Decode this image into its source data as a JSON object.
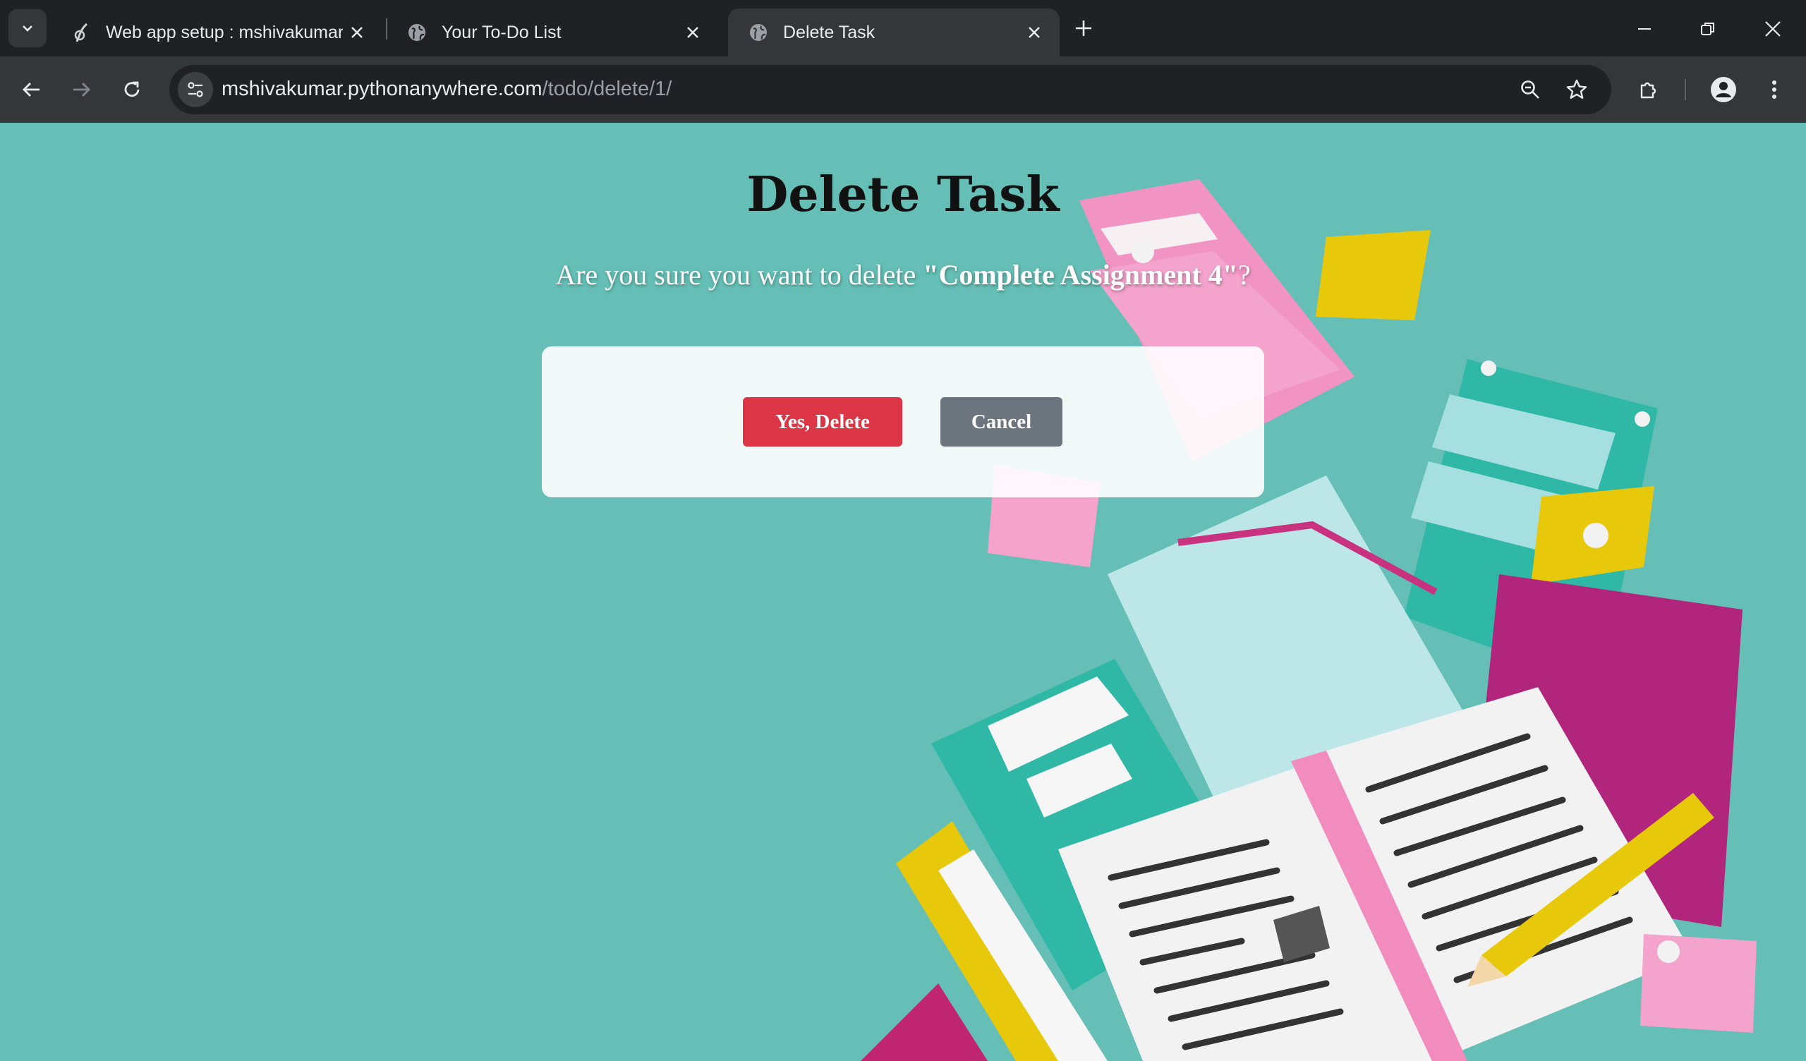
{
  "browser": {
    "tabs": [
      {
        "title": "Web app setup : mshivakumar :",
        "favicon": "pythonanywhere-icon",
        "active": false
      },
      {
        "title": "Your To-Do List",
        "favicon": "globe-icon",
        "active": false
      },
      {
        "title": "Delete Task",
        "favicon": "globe-icon",
        "active": true
      }
    ],
    "url_host": "mshivakumar.pythonanywhere.com",
    "url_path": "/todo/delete/1/"
  },
  "page": {
    "title": "Delete Task",
    "prompt_prefix": "Are you sure you want to delete ",
    "task_name": "\"Complete Assignment 4\"",
    "prompt_suffix": "?",
    "confirm_label": "Yes, Delete",
    "cancel_label": "Cancel"
  },
  "colors": {
    "page_background": "#65bfb6",
    "delete_button": "#dc3545",
    "cancel_button": "#6c757d",
    "browser_chrome": "#202124",
    "toolbar": "#35363a"
  }
}
